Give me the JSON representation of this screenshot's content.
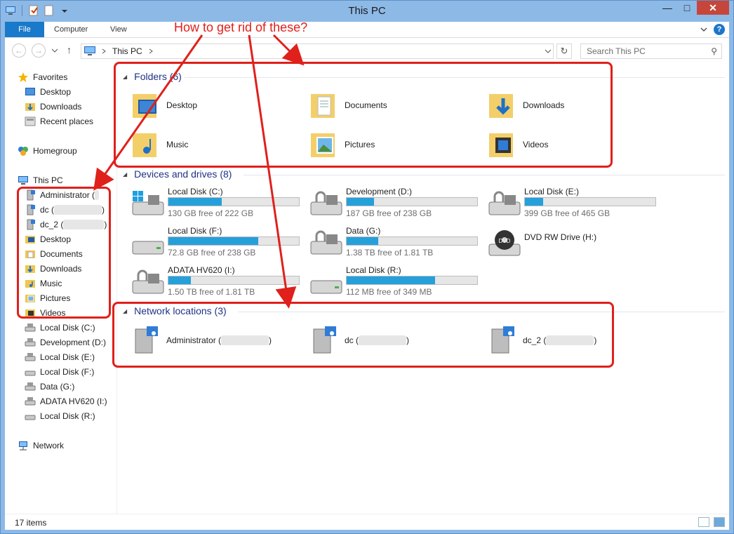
{
  "window": {
    "title": "This PC"
  },
  "ribbon": {
    "tabs": [
      "File",
      "Computer",
      "View"
    ]
  },
  "address": {
    "crumb": "This PC"
  },
  "search": {
    "placeholder": "Search This PC"
  },
  "annotation": {
    "text": "How to get rid of these?",
    "color": "#e0201b"
  },
  "navpane": {
    "favorites": {
      "label": "Favorites",
      "items": [
        "Desktop",
        "Downloads",
        "Recent places"
      ]
    },
    "homegroup": "Homegroup",
    "thispc": {
      "label": "This PC",
      "items": [
        "Administrator (",
        "dc (",
        ")",
        "dc_2 (",
        ")",
        "Desktop",
        "Documents",
        "Downloads",
        "Music",
        "Pictures",
        "Videos",
        "Local Disk (C:)",
        "Development (D:)",
        "Local Disk (E:)",
        "Local Disk (F:)",
        "Data (G:)",
        "ADATA HV620 (I:)",
        "Local Disk (R:)"
      ]
    },
    "network": "Network"
  },
  "groups": {
    "folders": {
      "title": "Folders (6)"
    },
    "devices": {
      "title": "Devices and drives (8)"
    },
    "network": {
      "title": "Network locations (3)"
    }
  },
  "folders": [
    "Desktop",
    "Documents",
    "Downloads",
    "Music",
    "Pictures",
    "Videos"
  ],
  "drives": [
    {
      "name": "Local Disk (C:)",
      "free": "130 GB free of 222 GB",
      "used_fraction": 0.41
    },
    {
      "name": "Development (D:)",
      "free": "187 GB free of 238 GB",
      "used_fraction": 0.21
    },
    {
      "name": "Local Disk (E:)",
      "free": "399 GB free of 465 GB",
      "used_fraction": 0.14
    },
    {
      "name": "Local Disk (F:)",
      "free": "72.8 GB free of 238 GB",
      "used_fraction": 0.69
    },
    {
      "name": "Data (G:)",
      "free": "1.38 TB free of 1.81 TB",
      "used_fraction": 0.24
    },
    {
      "name": "DVD RW Drive (H:)",
      "free": "",
      "used_fraction": null
    },
    {
      "name": "ADATA HV620 (I:)",
      "free": "1.50 TB free of 1.81 TB",
      "used_fraction": 0.17
    },
    {
      "name": "Local Disk (R:)",
      "free": "112 MB free of 349 MB",
      "used_fraction": 0.68
    }
  ],
  "network_locations": [
    {
      "prefix": "Administrator (",
      "suffix": ")"
    },
    {
      "prefix": "dc (",
      "suffix": ")"
    },
    {
      "prefix": "dc_2 (",
      "suffix": ")"
    }
  ],
  "status": {
    "count": "17 items"
  }
}
